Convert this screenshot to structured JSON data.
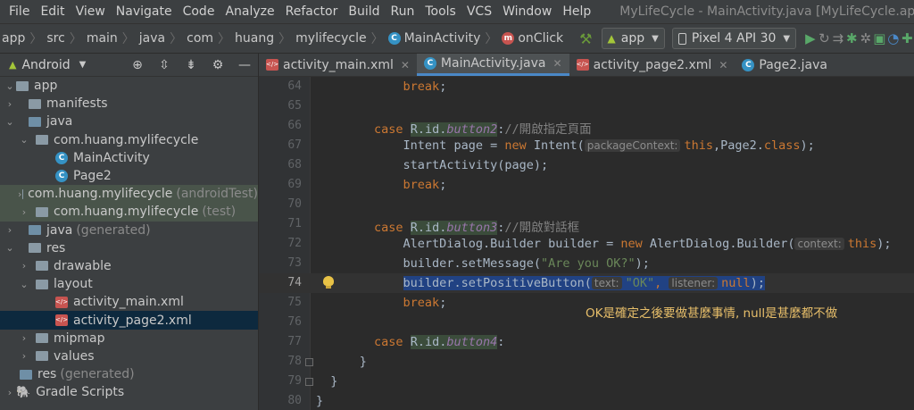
{
  "menu": [
    "File",
    "Edit",
    "View",
    "Navigate",
    "Code",
    "Analyze",
    "Refactor",
    "Build",
    "Run",
    "Tools",
    "VCS",
    "Window",
    "Help"
  ],
  "window_title": "MyLifeCycle - MainActivity.java [MyLifeCycle.app]",
  "breadcrumb": [
    "app",
    "src",
    "main",
    "java",
    "com",
    "huang",
    "mylifecycle",
    "MainActivity",
    "onClick"
  ],
  "run_config": "app",
  "device": "Pixel 4 API 30",
  "project_view": "Android",
  "tree": [
    {
      "label": "app"
    },
    {
      "label": "manifests"
    },
    {
      "label": "java"
    },
    {
      "label": "com.huang.mylifecycle"
    },
    {
      "label": "MainActivity"
    },
    {
      "label": "Page2"
    },
    {
      "label": "com.huang.mylifecycle",
      "suffix": "(androidTest)"
    },
    {
      "label": "com.huang.mylifecycle",
      "suffix": "(test)"
    },
    {
      "label": "java",
      "suffix": "(generated)"
    },
    {
      "label": "res"
    },
    {
      "label": "drawable"
    },
    {
      "label": "layout"
    },
    {
      "label": "activity_main.xml"
    },
    {
      "label": "activity_page2.xml"
    },
    {
      "label": "mipmap"
    },
    {
      "label": "values"
    },
    {
      "label": "res",
      "suffix": "(generated)"
    },
    {
      "label": "Gradle Scripts"
    }
  ],
  "tabs": [
    {
      "label": "activity_main.xml"
    },
    {
      "label": "MainActivity.java"
    },
    {
      "label": "activity_page2.xml"
    },
    {
      "label": "Page2.java"
    }
  ],
  "code": {
    "l64": {
      "num": "64",
      "kw": "break",
      "semi": ";"
    },
    "l65": {
      "num": "65"
    },
    "l66": {
      "num": "66",
      "kw": "case",
      "rid": "R.id.",
      "fld": "button2",
      "colon": ":",
      "cmt": "//開啟指定頁面"
    },
    "l67": {
      "num": "67",
      "a": "Intent page = ",
      "kw": "new",
      "b": " Intent(",
      "hint": "packageContext:",
      "kw2": "this",
      "c": ",Page2.",
      "kw3": "class",
      "d": ");"
    },
    "l68": {
      "num": "68",
      "a": "startActivity(page);"
    },
    "l69": {
      "num": "69",
      "kw": "break",
      "semi": ";"
    },
    "l70": {
      "num": "70"
    },
    "l71": {
      "num": "71",
      "kw": "case",
      "rid": "R.id.",
      "fld": "button3",
      "colon": ":",
      "cmt": "//開啟對話框"
    },
    "l72": {
      "num": "72",
      "a": "AlertDialog.Builder builder = ",
      "kw": "new",
      "b": " AlertDialog.Builder(",
      "hint": "context:",
      "kw2": "this",
      "d": ");"
    },
    "l73": {
      "num": "73",
      "a": "builder.setMessage(",
      "str": "\"Are you OK?\"",
      "d": ");"
    },
    "l74": {
      "num": "74",
      "a": "builder.setPositiveButton(",
      "hint1": "text:",
      "str": "\"OK\"",
      "comma": ",",
      "hint2": "listener:",
      "kw": "null",
      "d": ");"
    },
    "l75": {
      "num": "75",
      "kw": "break",
      "semi": ";"
    },
    "l76": {
      "num": "76"
    },
    "l77": {
      "num": "77",
      "kw": "case",
      "rid": "R.id.",
      "fld": "button4",
      "colon": ":"
    },
    "l78": {
      "num": "78",
      "a": "}"
    },
    "l79": {
      "num": "79",
      "a": "}"
    },
    "l80": {
      "num": "80",
      "a": "}"
    }
  },
  "note": "OK是確定之後要做甚麼事情, null是甚麼都不做"
}
